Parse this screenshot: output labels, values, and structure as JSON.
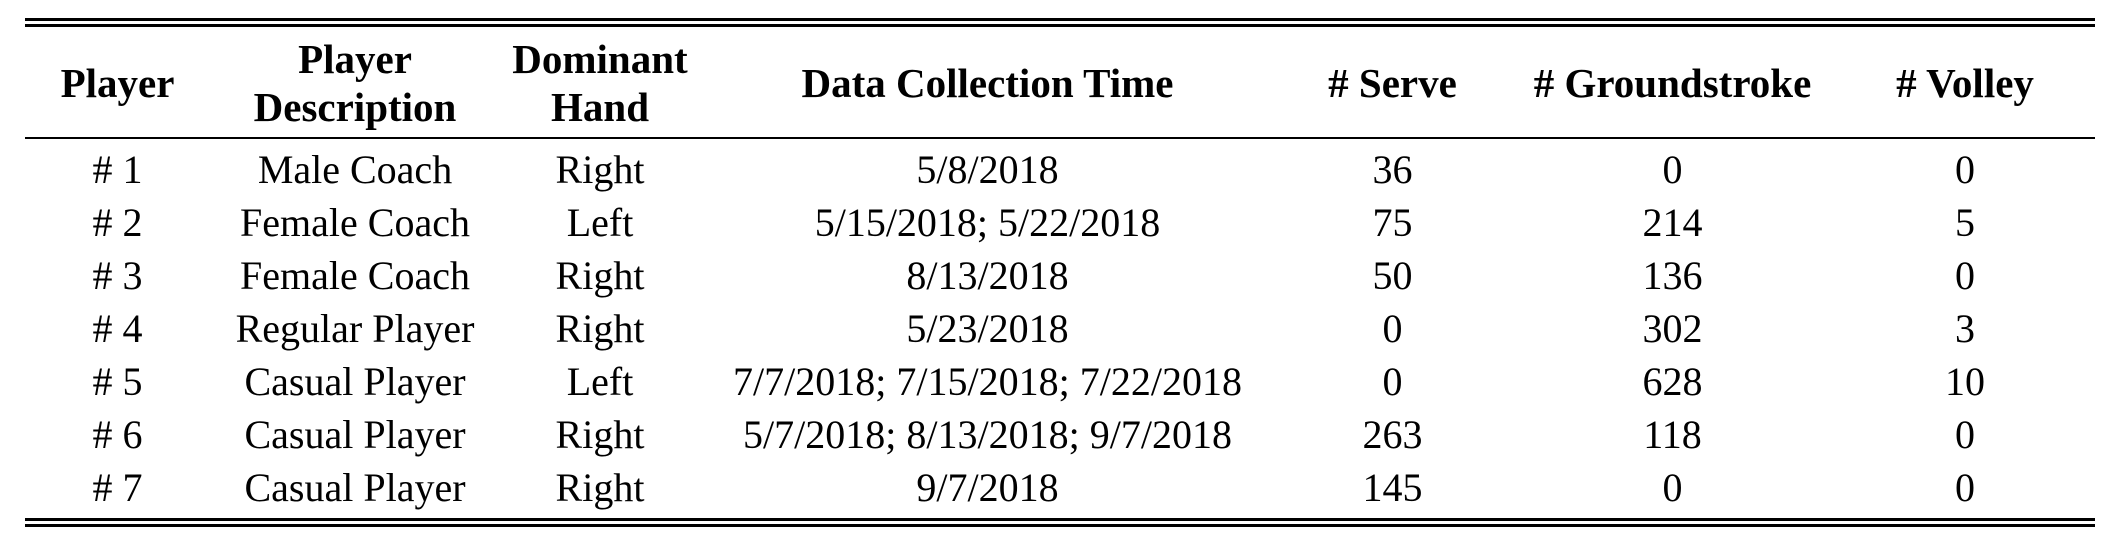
{
  "table": {
    "headers": [
      {
        "line1": "Player",
        "line2": ""
      },
      {
        "line1": "Player",
        "line2": "Description"
      },
      {
        "line1": "Dominant",
        "line2": "Hand"
      },
      {
        "line1": "Data Collection Time",
        "line2": ""
      },
      {
        "line1": "# Serve",
        "line2": ""
      },
      {
        "line1": "# Groundstroke",
        "line2": ""
      },
      {
        "line1": "# Volley",
        "line2": ""
      }
    ],
    "rows": [
      [
        "# 1",
        "Male Coach",
        "Right",
        "5/8/2018",
        "36",
        "0",
        "0"
      ],
      [
        "# 2",
        "Female Coach",
        "Left",
        "5/15/2018; 5/22/2018",
        "75",
        "214",
        "5"
      ],
      [
        "# 3",
        "Female Coach",
        "Right",
        "8/13/2018",
        "50",
        "136",
        "0"
      ],
      [
        "# 4",
        "Regular Player",
        "Right",
        "5/23/2018",
        "0",
        "302",
        "3"
      ],
      [
        "# 5",
        "Casual Player",
        "Left",
        "7/7/2018; 7/15/2018; 7/22/2018",
        "0",
        "628",
        "10"
      ],
      [
        "# 6",
        "Casual Player",
        "Right",
        "5/7/2018; 8/13/2018; 9/7/2018",
        "263",
        "118",
        "0"
      ],
      [
        "# 7",
        "Casual Player",
        "Right",
        "9/7/2018",
        "145",
        "0",
        "0"
      ]
    ]
  }
}
